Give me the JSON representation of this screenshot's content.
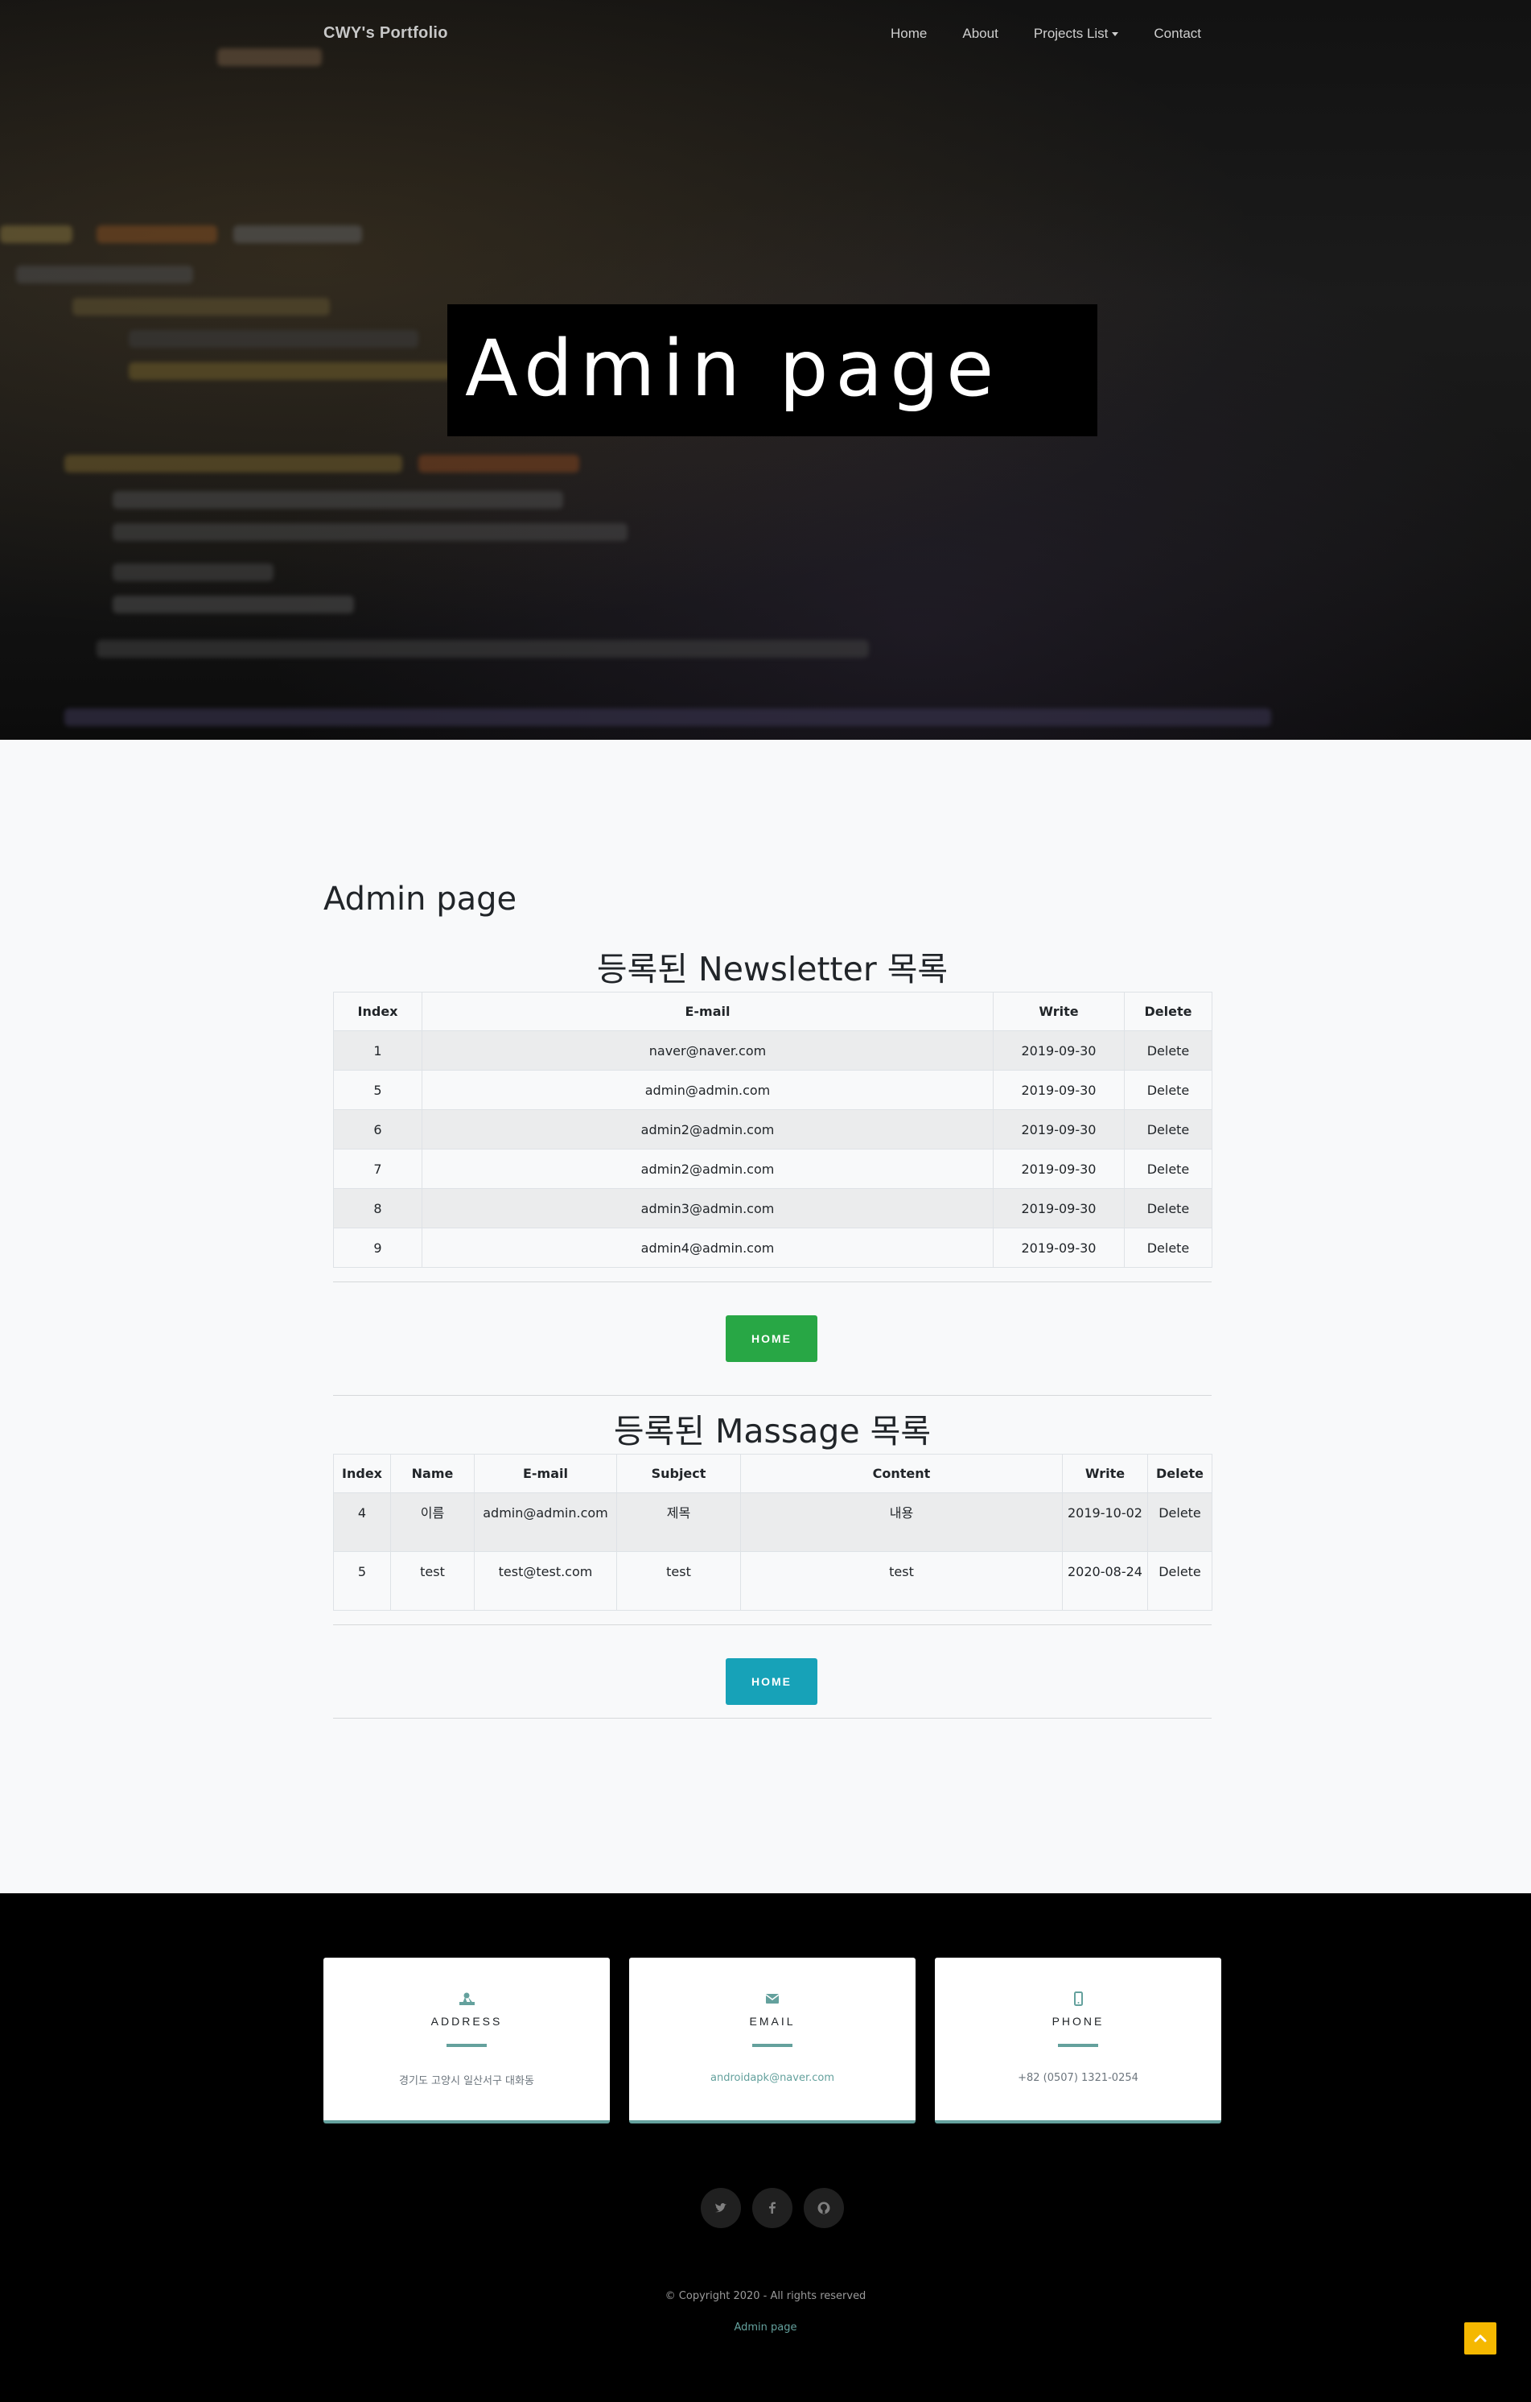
{
  "nav": {
    "brand": "CWY's Portfolio",
    "links": [
      "Home",
      "About",
      "Projects List",
      "Contact"
    ]
  },
  "hero": {
    "title": "Admin page"
  },
  "main": {
    "heading": "Admin page",
    "newsletter": {
      "title": "등록된 Newsletter 목록",
      "columns": [
        "Index",
        "E-mail",
        "Write",
        "Delete"
      ],
      "rows": [
        [
          "1",
          "naver@naver.com",
          "2019-09-30",
          "Delete"
        ],
        [
          "5",
          "admin@admin.com",
          "2019-09-30",
          "Delete"
        ],
        [
          "6",
          "admin2@admin.com",
          "2019-09-30",
          "Delete"
        ],
        [
          "7",
          "admin2@admin.com",
          "2019-09-30",
          "Delete"
        ],
        [
          "8",
          "admin3@admin.com",
          "2019-09-30",
          "Delete"
        ],
        [
          "9",
          "admin4@admin.com",
          "2019-09-30",
          "Delete"
        ]
      ],
      "button_label": "HOME",
      "button_color": "#28a745"
    },
    "messages": {
      "title": "등록된 Massage 목록",
      "columns": [
        "Index",
        "Name",
        "E-mail",
        "Subject",
        "Content",
        "Write",
        "Delete"
      ],
      "rows": [
        [
          "4",
          "이름",
          "admin@admin.com",
          "제목",
          "내용",
          "2019-10-02",
          "Delete"
        ],
        [
          "5",
          "test",
          "test@test.com",
          "test",
          "test",
          "2020-08-24",
          "Delete"
        ]
      ],
      "button_label": "HOME",
      "button_color": "#17a2b8"
    }
  },
  "footer": {
    "cards": [
      {
        "icon": "map-marked-icon",
        "label": "ADDRESS",
        "value": "경기도 고양시 일산서구 대화동"
      },
      {
        "icon": "envelope-icon",
        "label": "EMAIL",
        "value": "androidapk@naver.com"
      },
      {
        "icon": "mobile-phone-icon",
        "label": "PHONE",
        "value": "+82 (0507) 1321-0254"
      }
    ],
    "social": [
      "twitter-icon",
      "facebook-icon",
      "github-icon"
    ],
    "copyright": "© Copyright 2020 - All rights reserved",
    "admin_link": "Admin page"
  },
  "colors": {
    "accent": "#64a19d",
    "top_button": "#f5b800"
  }
}
